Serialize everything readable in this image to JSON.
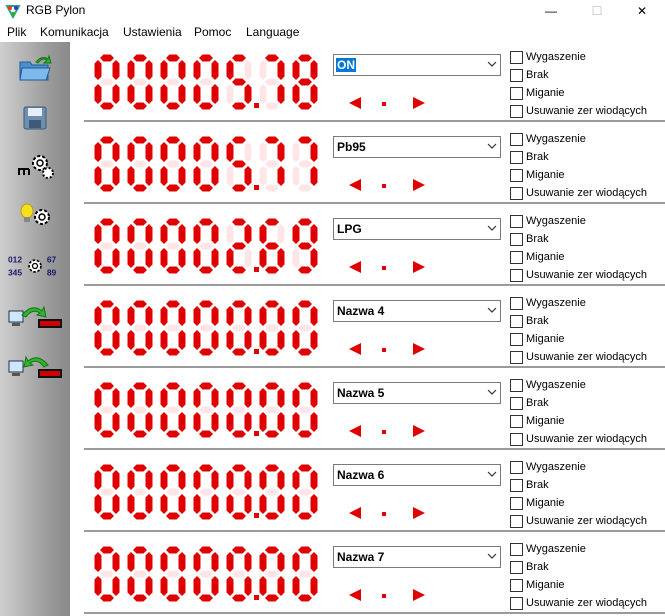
{
  "window": {
    "title": "RGB Pylon"
  },
  "menu": [
    "Plik",
    "Komunikacja",
    "Ustawienia",
    "Pomoc",
    "Language"
  ],
  "toolbar": [
    {
      "icon": "open-folder-icon"
    },
    {
      "icon": "save-disk-icon"
    },
    {
      "icon": "network-settings-icon"
    },
    {
      "icon": "brightness-settings-icon"
    },
    {
      "icon": "digits-settings-icon",
      "digits_top": "012",
      "digits_top_right": "67",
      "digits_bottom": "345",
      "digits_bottom_right": "89"
    },
    {
      "icon": "send-to-display-icon"
    },
    {
      "icon": "read-from-display-icon"
    }
  ],
  "colors": {
    "segment_on": "#e00000",
    "segment_off": "#ffe5e5",
    "select_highlight": "#0078d7"
  },
  "rows": [
    {
      "digits": "0000578",
      "decimal_after": 4,
      "name": "ON",
      "selected": true
    },
    {
      "digits": "0000577",
      "decimal_after": 4,
      "name": "Pb95",
      "selected": false
    },
    {
      "digits": "0000269",
      "decimal_after": 4,
      "name": "LPG",
      "selected": false
    },
    {
      "digits": "0000000",
      "decimal_after": 4,
      "name": "Nazwa 4",
      "selected": false
    },
    {
      "digits": "0000000",
      "decimal_after": 4,
      "name": "Nazwa 5",
      "selected": false
    },
    {
      "digits": "0000000",
      "decimal_after": 4,
      "name": "Nazwa 6",
      "selected": false
    },
    {
      "digits": "0000000",
      "decimal_after": 4,
      "name": "Nazwa 7",
      "selected": false
    }
  ],
  "checkbox_labels": [
    "Wygaszenie",
    "Brak",
    "Miganie",
    "Usuwanie zer wiodących"
  ]
}
